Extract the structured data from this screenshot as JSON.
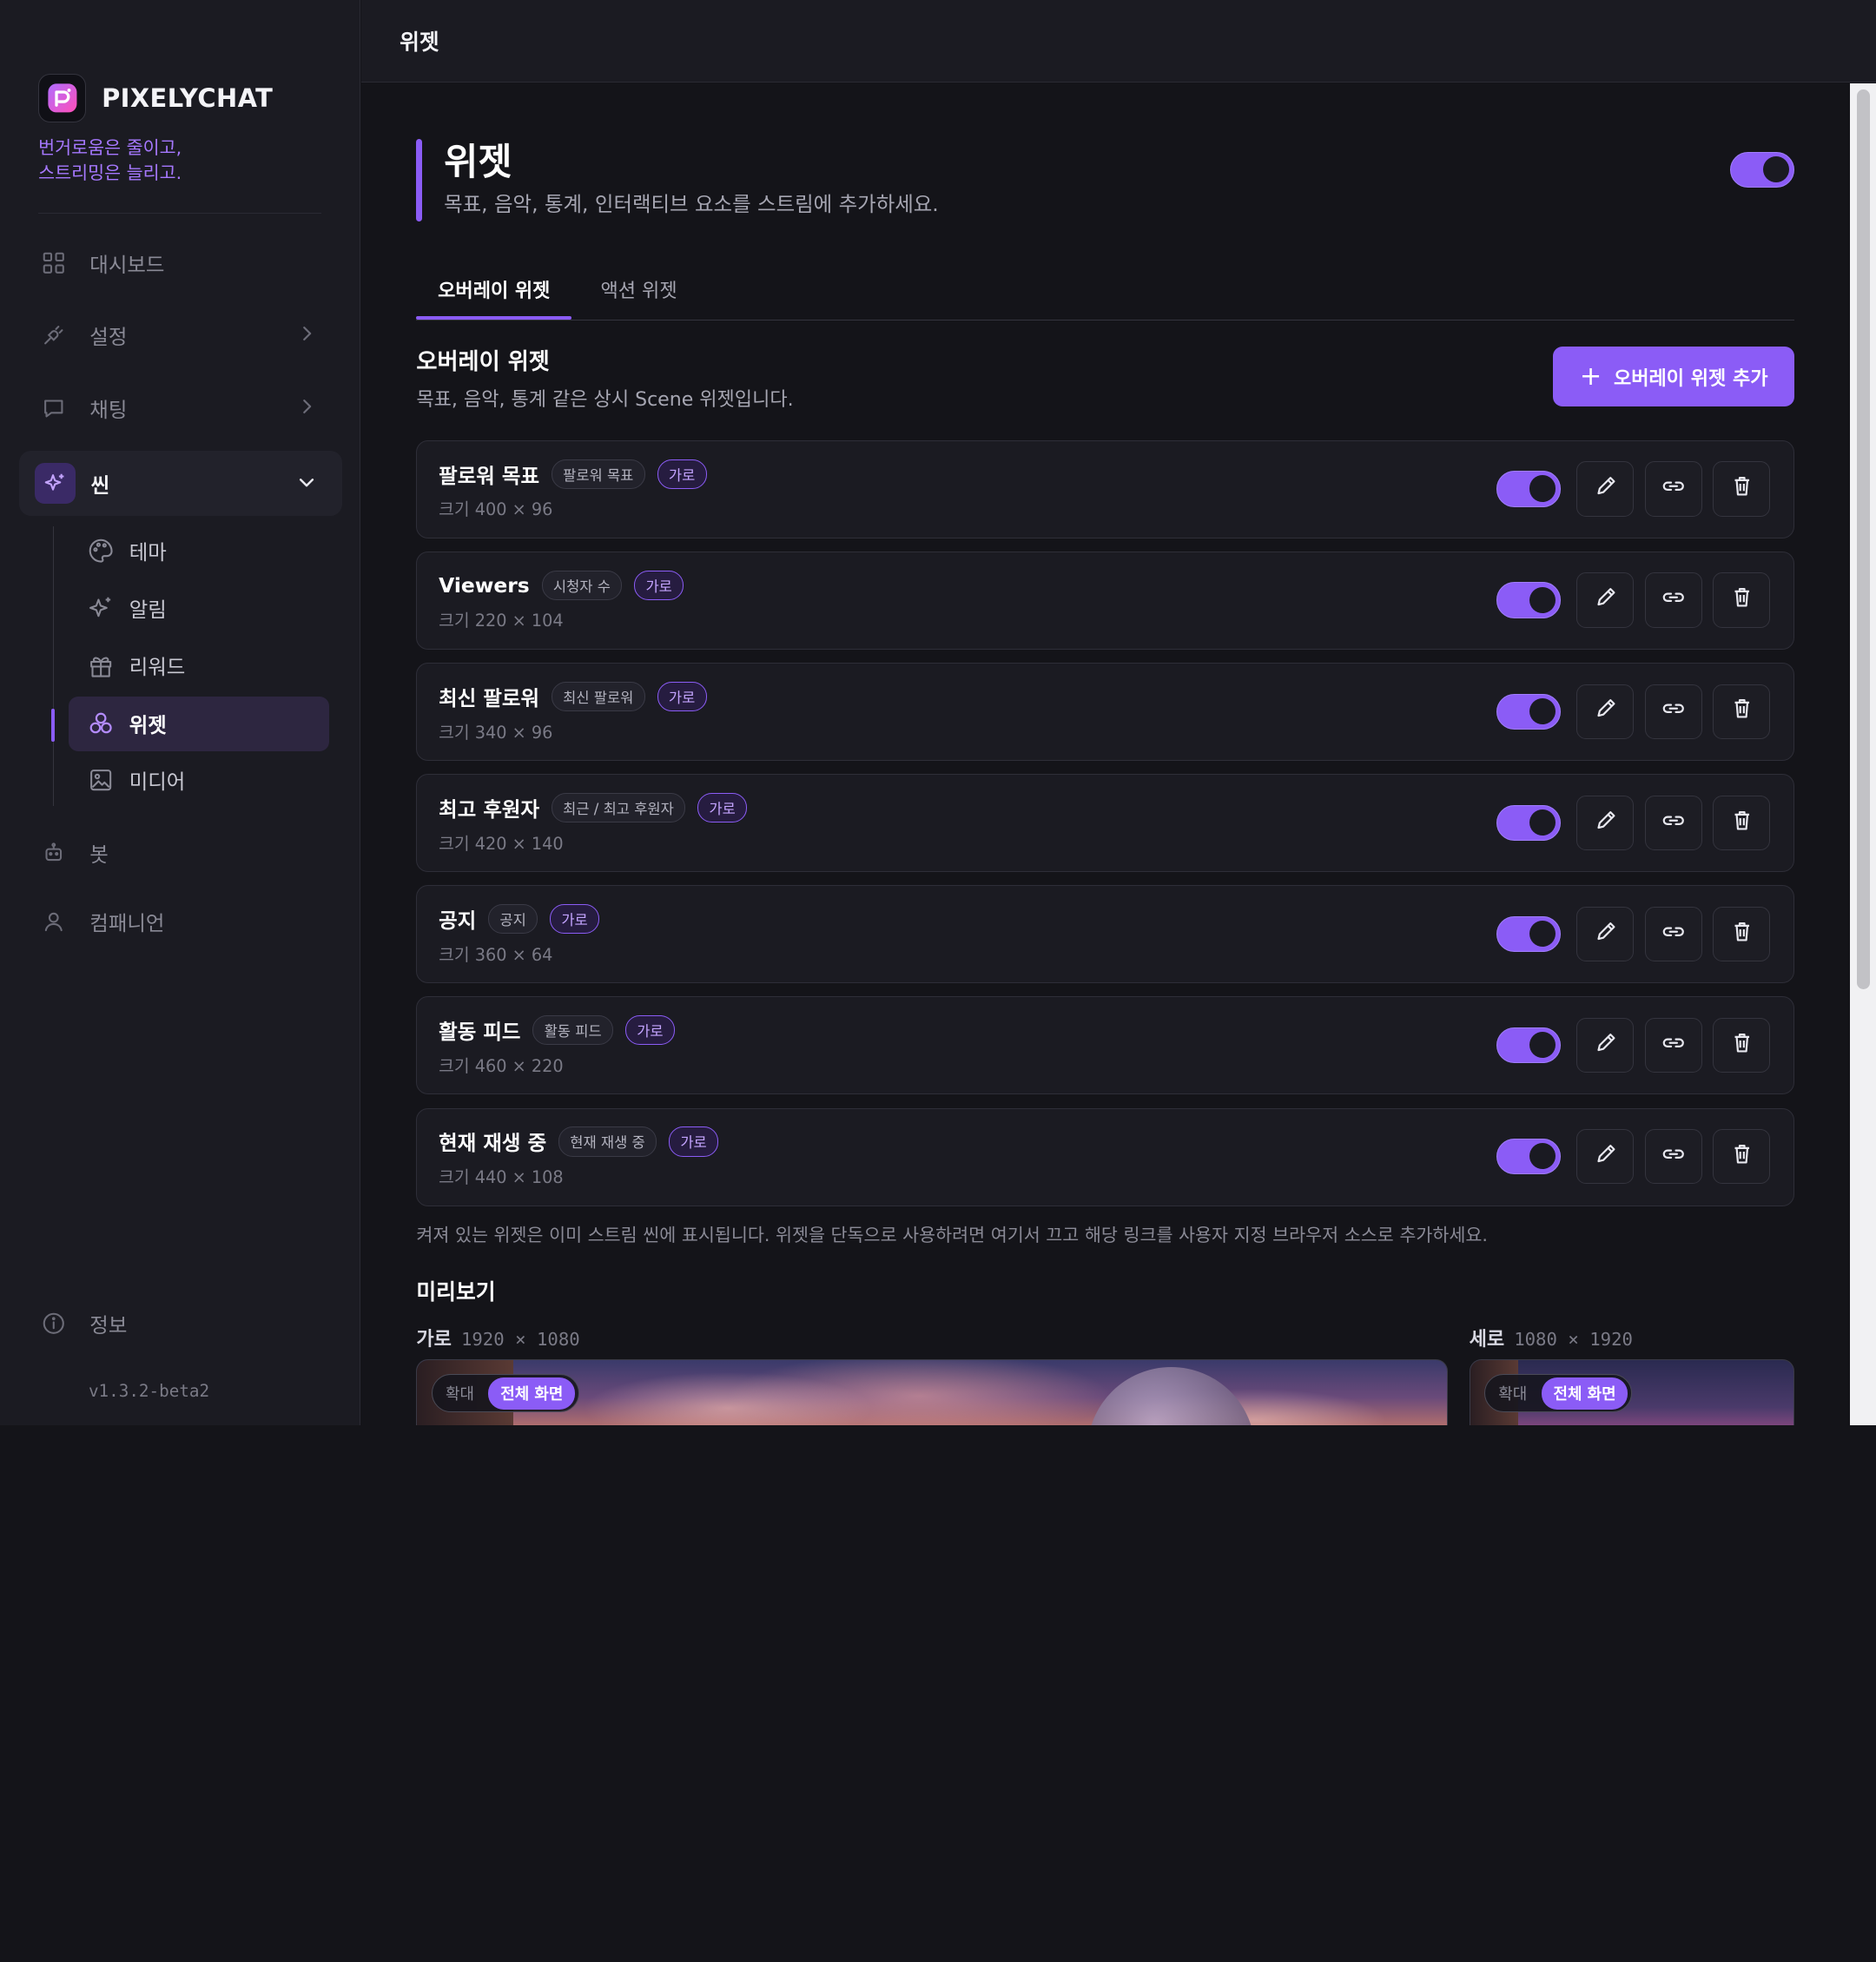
{
  "brand": {
    "name": "PIXELYCHAT",
    "tagline": [
      "번거로움은 줄이고,",
      "스트리밍은 늘리고."
    ]
  },
  "sidebar": {
    "items": [
      {
        "label": "대시보드",
        "icon": "grid-icon"
      },
      {
        "label": "설정",
        "icon": "plug-icon"
      },
      {
        "label": "채팅",
        "icon": "chat-icon"
      },
      {
        "label": "씬",
        "icon": "sparkle-icon"
      },
      {
        "label": "봇",
        "icon": "bot-icon"
      },
      {
        "label": "컴패니언",
        "icon": "user-icon"
      }
    ],
    "scene_sub": [
      {
        "label": "테마",
        "icon": "palette-icon"
      },
      {
        "label": "알림",
        "icon": "sparkle-icon"
      },
      {
        "label": "리워드",
        "icon": "gift-icon"
      },
      {
        "label": "위젯",
        "icon": "widgets-icon"
      },
      {
        "label": "미디어",
        "icon": "image-icon"
      }
    ],
    "info_label": "정보",
    "version": "v1.3.2-beta2"
  },
  "topbar": {
    "title": "위젯"
  },
  "page": {
    "title": "위젯",
    "subtitle": "목표, 음악, 통계, 인터랙티브 요소를 스트림에 추가하세요.",
    "master_toggle": true
  },
  "tabs": [
    {
      "label": "오버레이 위젯",
      "active": true
    },
    {
      "label": "액션 위젯",
      "active": false
    }
  ],
  "section": {
    "title": "오버레이 위젯",
    "subtitle": "목표, 음악, 통계 같은 상시 Scene 위젯입니다.",
    "add_button": "오버레이 위젯 추가"
  },
  "widgets": [
    {
      "name": "팔로워 목표",
      "type": "팔로워 목표",
      "orientation": "가로",
      "size": "크기 400 × 96",
      "enabled": true
    },
    {
      "name": "Viewers",
      "type": "시청자 수",
      "orientation": "가로",
      "size": "크기 220 × 104",
      "enabled": true
    },
    {
      "name": "최신 팔로워",
      "type": "최신 팔로워",
      "orientation": "가로",
      "size": "크기 340 × 96",
      "enabled": true
    },
    {
      "name": "최고 후원자",
      "type": "최근 / 최고 후원자",
      "orientation": "가로",
      "size": "크기 420 × 140",
      "enabled": true
    },
    {
      "name": "공지",
      "type": "공지",
      "orientation": "가로",
      "size": "크기 360 × 64",
      "enabled": true
    },
    {
      "name": "활동 피드",
      "type": "활동 피드",
      "orientation": "가로",
      "size": "크기 460 × 220",
      "enabled": true
    },
    {
      "name": "현재 재생 중",
      "type": "현재 재생 중",
      "orientation": "가로",
      "size": "크기 440 × 108",
      "enabled": true
    }
  ],
  "note": "켜져 있는 위젯은 이미 스트림 씬에 표시됩니다. 위젯을 단독으로 사용하려면 여기서 끄고 해당 링크를 사용자 지정 브라우저 소스로 추가하세요.",
  "preview": {
    "title": "미리보기",
    "landscape": {
      "label": "가로",
      "dims": "1920 × 1080"
    },
    "portrait": {
      "label": "세로",
      "dims": "1080 × 1920"
    },
    "zoom_label": "확대",
    "fullscreen_label": "전체 화면"
  },
  "colors": {
    "accent": "#8b5cf6",
    "background": "#141419",
    "panel": "#1b1b22"
  }
}
